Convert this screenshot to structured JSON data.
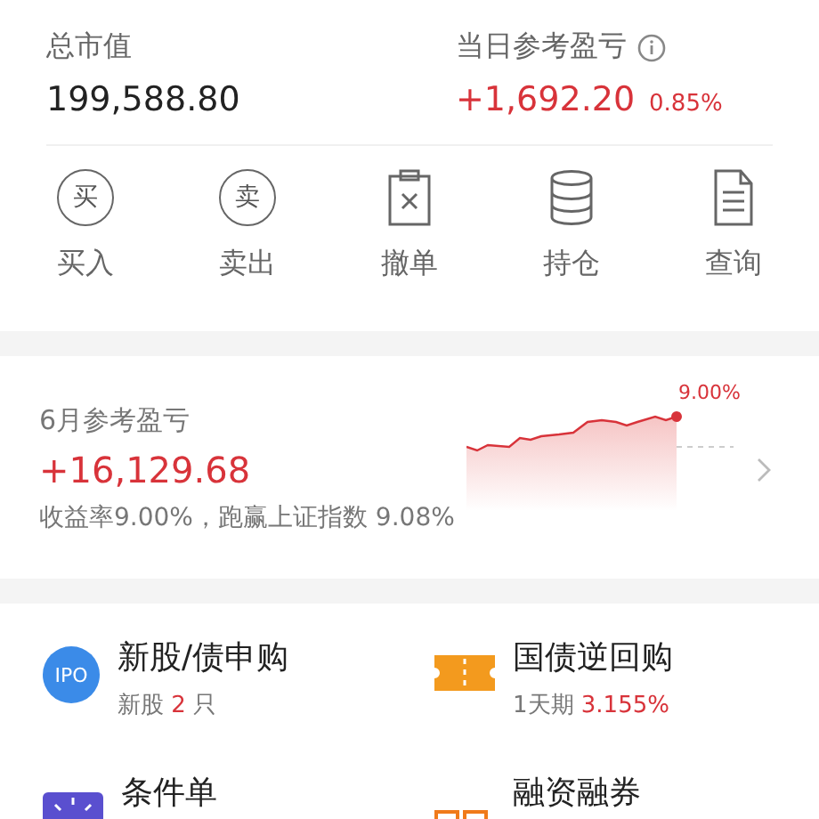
{
  "summary": {
    "total_label": "总市值",
    "total_value": "199,588.80",
    "daily_label": "当日参考盈亏",
    "daily_value": "+1,692.20",
    "daily_percent": "0.85%"
  },
  "actions": [
    {
      "kind": "buy",
      "label": "买入",
      "glyph": "买"
    },
    {
      "kind": "sell",
      "label": "卖出",
      "glyph": "卖"
    },
    {
      "kind": "cancel",
      "label": "撤单"
    },
    {
      "kind": "holdings",
      "label": "持仓"
    },
    {
      "kind": "query",
      "label": "查询"
    }
  ],
  "monthly": {
    "title": "6月参考盈亏",
    "value": "+16,129.68",
    "note": "收益率9.00%，跑赢上证指数 9.08%",
    "chart_label": "9.00%"
  },
  "services": [
    {
      "kind": "ipo",
      "icon_text": "IPO",
      "title": "新股/债申购",
      "sub_prefix": "新股 ",
      "sub_value": "2",
      "sub_suffix": " 只"
    },
    {
      "kind": "repo",
      "title": "国债逆回购",
      "sub_prefix": "1天期 ",
      "sub_value": "3.155%"
    },
    {
      "kind": "condition",
      "title": "条件单"
    },
    {
      "kind": "margin",
      "title": "融资融券"
    }
  ]
}
